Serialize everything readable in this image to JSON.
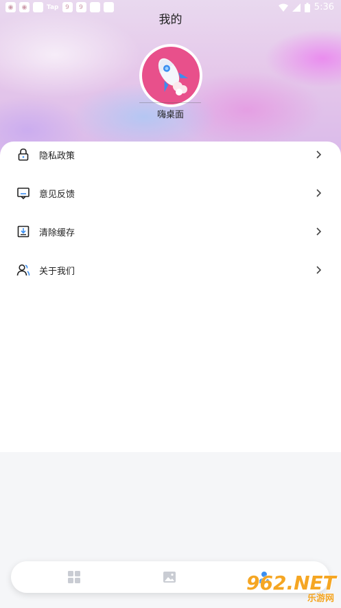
{
  "status_bar": {
    "time": "5:36",
    "tap_label": "Tap"
  },
  "header": {
    "title": "我的"
  },
  "profile": {
    "username": "嗨桌面"
  },
  "menu": {
    "items": [
      {
        "label": "隐私政策",
        "icon": "lock-icon"
      },
      {
        "label": "意见反馈",
        "icon": "feedback-icon"
      },
      {
        "label": "清除缓存",
        "icon": "download-box-icon"
      },
      {
        "label": "关于我们",
        "icon": "users-icon"
      }
    ]
  },
  "tabbar": {
    "tabs": [
      {
        "icon": "grid-icon"
      },
      {
        "icon": "image-icon"
      },
      {
        "icon": "person-icon"
      }
    ]
  },
  "watermark": {
    "big": "962.NET",
    "small": "乐游网"
  },
  "colors": {
    "avatar_bg": "#e8508b",
    "accent_blue": "#3a8ef0",
    "watermark": "#f5a623"
  }
}
